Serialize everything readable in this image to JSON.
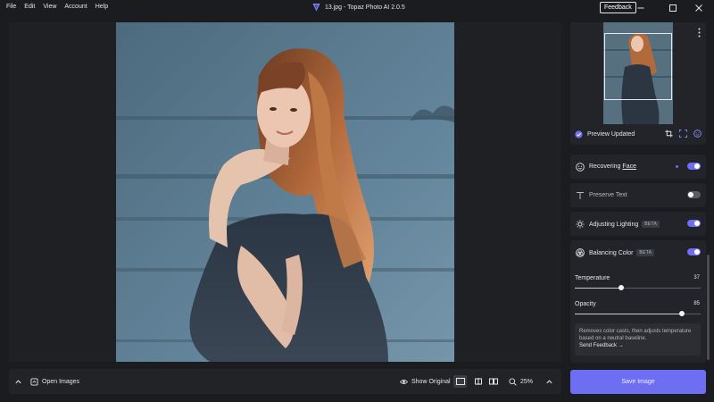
{
  "menu": [
    "File",
    "Edit",
    "View",
    "Account",
    "Help"
  ],
  "window": {
    "title": "13.jpg - Topaz Photo AI 2.0.5",
    "feedback_label": "Feedback"
  },
  "bottombar": {
    "open_images_label": "Open Images",
    "show_original_label": "Show Original",
    "zoom_label": "25%"
  },
  "preview": {
    "status_label": "Preview Updated"
  },
  "panels": {
    "face": {
      "label_prefix": "Recovering",
      "label_link": "Face",
      "enabled": true
    },
    "text": {
      "label": "Preserve Text",
      "enabled": false
    },
    "lighting": {
      "label": "Adjusting Lighting",
      "badge": "BETA",
      "enabled": true
    },
    "color": {
      "label": "Balancing Color",
      "badge": "BETA",
      "enabled": true,
      "temperature": {
        "label": "Temperature",
        "value": "37",
        "fraction": 0.37
      },
      "opacity": {
        "label": "Opacity",
        "value": "85",
        "fraction": 0.85
      },
      "info_text": "Removes color casts, then adjusts temperature based on a neutral baseline.",
      "info_link": "Send Feedback →"
    }
  },
  "save_label": "Save Image",
  "colors": {
    "accent": "#6e6ef2",
    "background": "#1b1c20",
    "panel": "#232429"
  }
}
